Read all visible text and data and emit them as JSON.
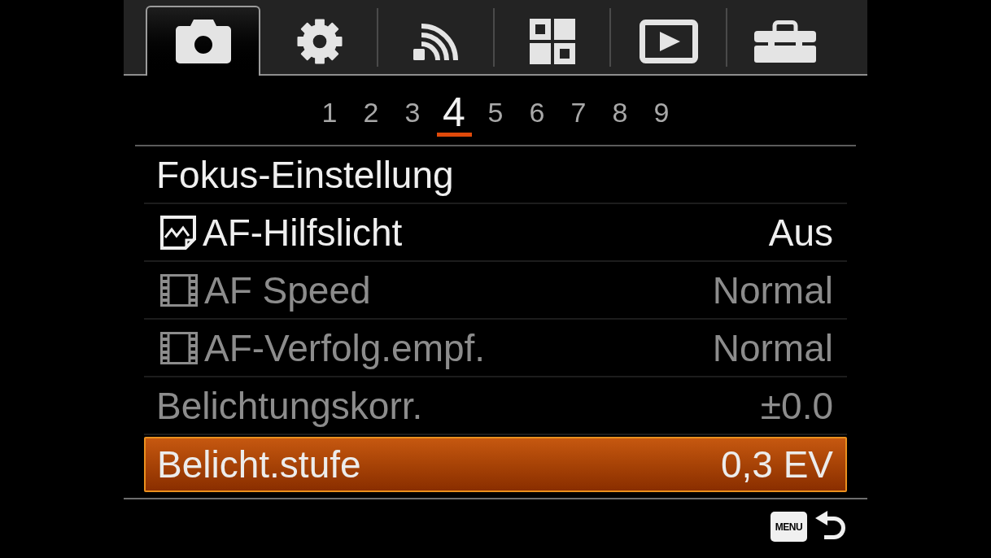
{
  "tabs": [
    {
      "kind": "camera",
      "selected": true
    },
    {
      "kind": "gear",
      "selected": false
    },
    {
      "kind": "wireless",
      "selected": false
    },
    {
      "kind": "grid",
      "selected": false
    },
    {
      "kind": "playback",
      "selected": false
    },
    {
      "kind": "toolbox",
      "selected": false
    }
  ],
  "pages": [
    {
      "label": "1",
      "selected": false
    },
    {
      "label": "2",
      "selected": false
    },
    {
      "label": "3",
      "selected": false
    },
    {
      "label": "4",
      "selected": true
    },
    {
      "label": "5",
      "selected": false
    },
    {
      "label": "6",
      "selected": false
    },
    {
      "label": "7",
      "selected": false
    },
    {
      "label": "8",
      "selected": false
    },
    {
      "label": "9",
      "selected": false
    }
  ],
  "section_title": "Fokus-Einstellung",
  "rows": [
    {
      "kind": "still",
      "label": "AF-Hilfslicht",
      "value": "Aus",
      "disabled": false,
      "selected": false
    },
    {
      "kind": "movie",
      "label": "AF Speed",
      "value": "Normal",
      "disabled": true,
      "selected": false
    },
    {
      "kind": "movie",
      "label": "AF-Verfolg.empf.",
      "value": "Normal",
      "disabled": true,
      "selected": false
    },
    {
      "kind": "plain",
      "label": "Belichtungskorr.",
      "value": "±0.0",
      "disabled": true,
      "selected": false
    },
    {
      "kind": "plain",
      "label": "Belicht.stufe",
      "value": "0,3 EV",
      "disabled": false,
      "selected": true
    }
  ],
  "footer": {
    "menu_key": "MENU"
  }
}
